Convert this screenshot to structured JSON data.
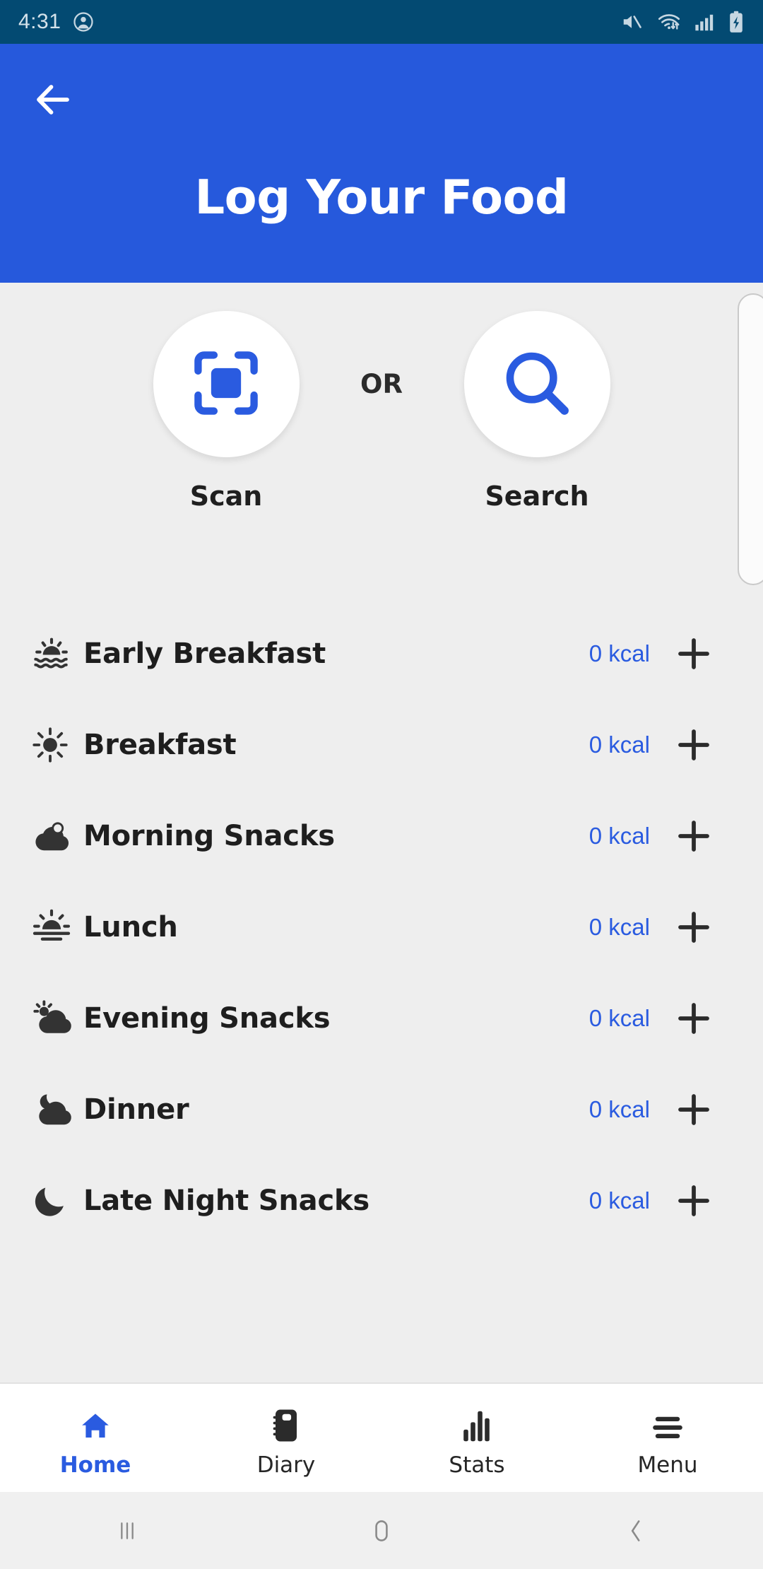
{
  "status_bar": {
    "time": "4:31",
    "left_icons": [
      "account-circle-icon"
    ],
    "right_icons": [
      "mute-icon",
      "wifi-transfer-icon",
      "cellular-signal-icon",
      "battery-charging-icon"
    ],
    "background_color": "#034A72",
    "text_color": "#D6E3EB"
  },
  "header": {
    "title": "Log Your Food",
    "back_icon": "back-arrow-icon",
    "background_color": "#2659DC",
    "title_color": "#FFFFFF"
  },
  "actions": {
    "scan": {
      "label": "Scan",
      "icon": "scan-frame-icon"
    },
    "separator": "OR",
    "search": {
      "label": "Search",
      "icon": "search-icon"
    },
    "icon_color": "#2A5BE0",
    "circle_color": "#FFFFFF"
  },
  "meals": [
    {
      "name": "Early Breakfast",
      "kcal": "0 kcal",
      "icon": "sunrise-waves-icon",
      "add": "+"
    },
    {
      "name": "Breakfast",
      "kcal": "0 kcal",
      "icon": "sun-icon",
      "add": "+"
    },
    {
      "name": "Morning Snacks",
      "kcal": "0 kcal",
      "icon": "cloud-sun-icon",
      "add": "+"
    },
    {
      "name": "Lunch",
      "kcal": "0 kcal",
      "icon": "sun-horizon-icon",
      "add": "+"
    },
    {
      "name": "Evening Snacks",
      "kcal": "0 kcal",
      "icon": "cloud-sun-rays-icon",
      "add": "+"
    },
    {
      "name": "Dinner",
      "kcal": "0 kcal",
      "icon": "cloud-moon-icon",
      "add": "+"
    },
    {
      "name": "Late Night Snacks",
      "kcal": "0 kcal",
      "icon": "crescent-moon-icon",
      "add": "+"
    }
  ],
  "meal_colors": {
    "name": "#1E1E1E",
    "kcal": "#2A5BE0",
    "add": "#2B2B2B"
  },
  "bottom_nav": {
    "items": [
      {
        "label": "Home",
        "icon": "home-icon",
        "active": true
      },
      {
        "label": "Diary",
        "icon": "notebook-icon",
        "active": false
      },
      {
        "label": "Stats",
        "icon": "bar-chart-icon",
        "active": false
      },
      {
        "label": "Menu",
        "icon": "hamburger-icon",
        "active": false
      }
    ],
    "active_color": "#2A5BE0",
    "inactive_color": "#262626"
  },
  "system_nav": {
    "buttons": [
      "recents-icon",
      "home-square-icon",
      "back-chevron-icon"
    ]
  },
  "page_background": "#EEEEEE"
}
